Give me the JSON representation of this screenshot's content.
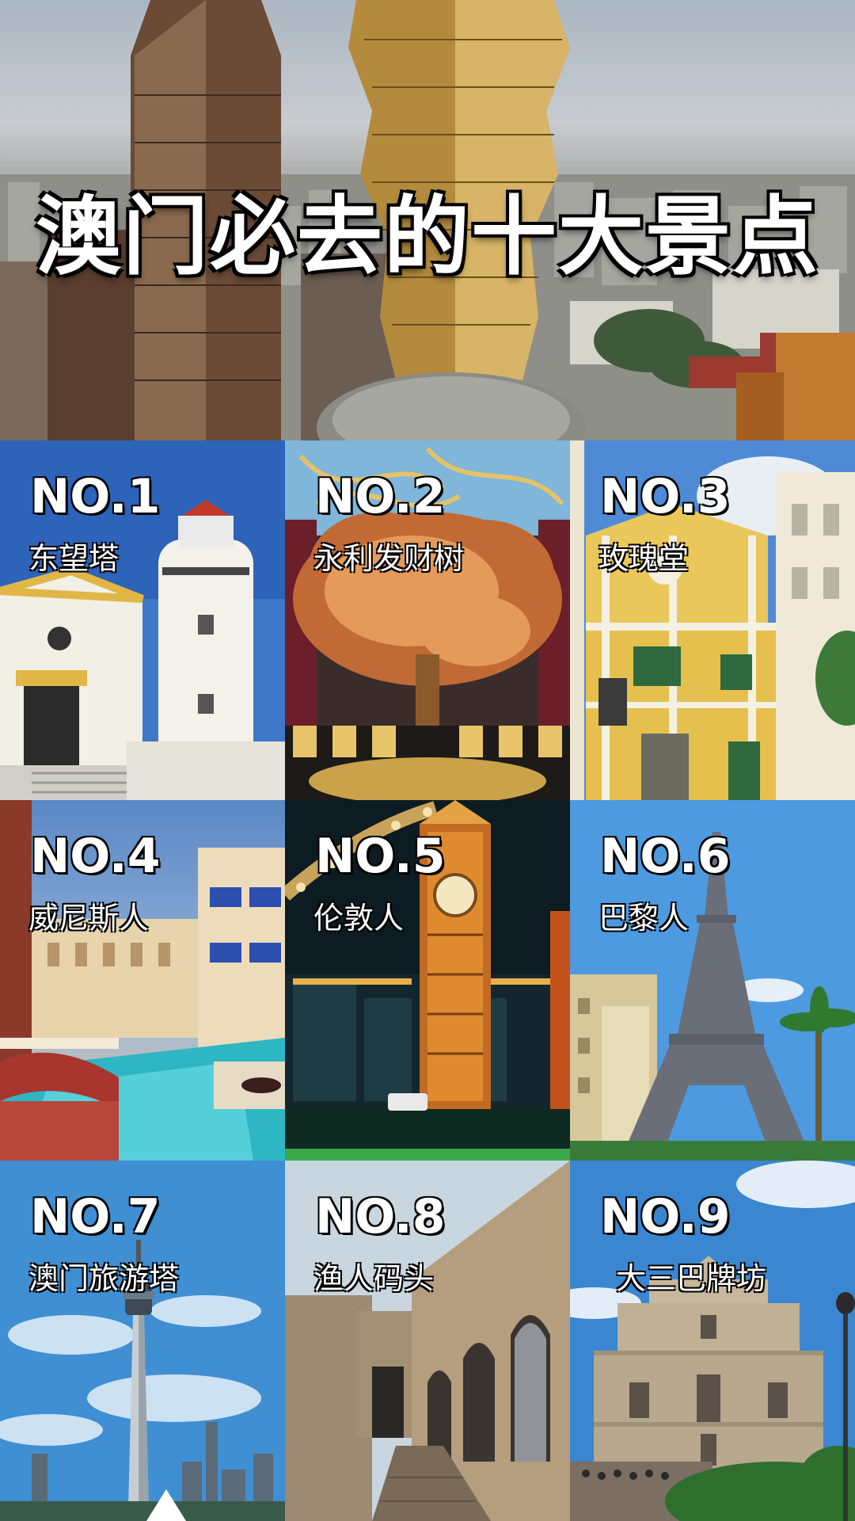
{
  "hero": {
    "title": "澳门必去的十大景点"
  },
  "spots": [
    {
      "rank": "NO.1",
      "name": "东望塔"
    },
    {
      "rank": "NO.2",
      "name": "永利发财树"
    },
    {
      "rank": "NO.3",
      "name": "玫瑰堂"
    },
    {
      "rank": "NO.4",
      "name": "威尼斯人"
    },
    {
      "rank": "NO.5",
      "name": "伦敦人"
    },
    {
      "rank": "NO.6",
      "name": "巴黎人"
    },
    {
      "rank": "NO.7",
      "name": "澳门旅游塔"
    },
    {
      "rank": "NO.8",
      "name": "渔人码头"
    },
    {
      "rank": "NO.9",
      "name": "大三巴牌坊"
    }
  ],
  "colors": {
    "sky_blue": "#4f8fd6",
    "gold": "#c9a24a",
    "church_yellow": "#e9c75a"
  }
}
